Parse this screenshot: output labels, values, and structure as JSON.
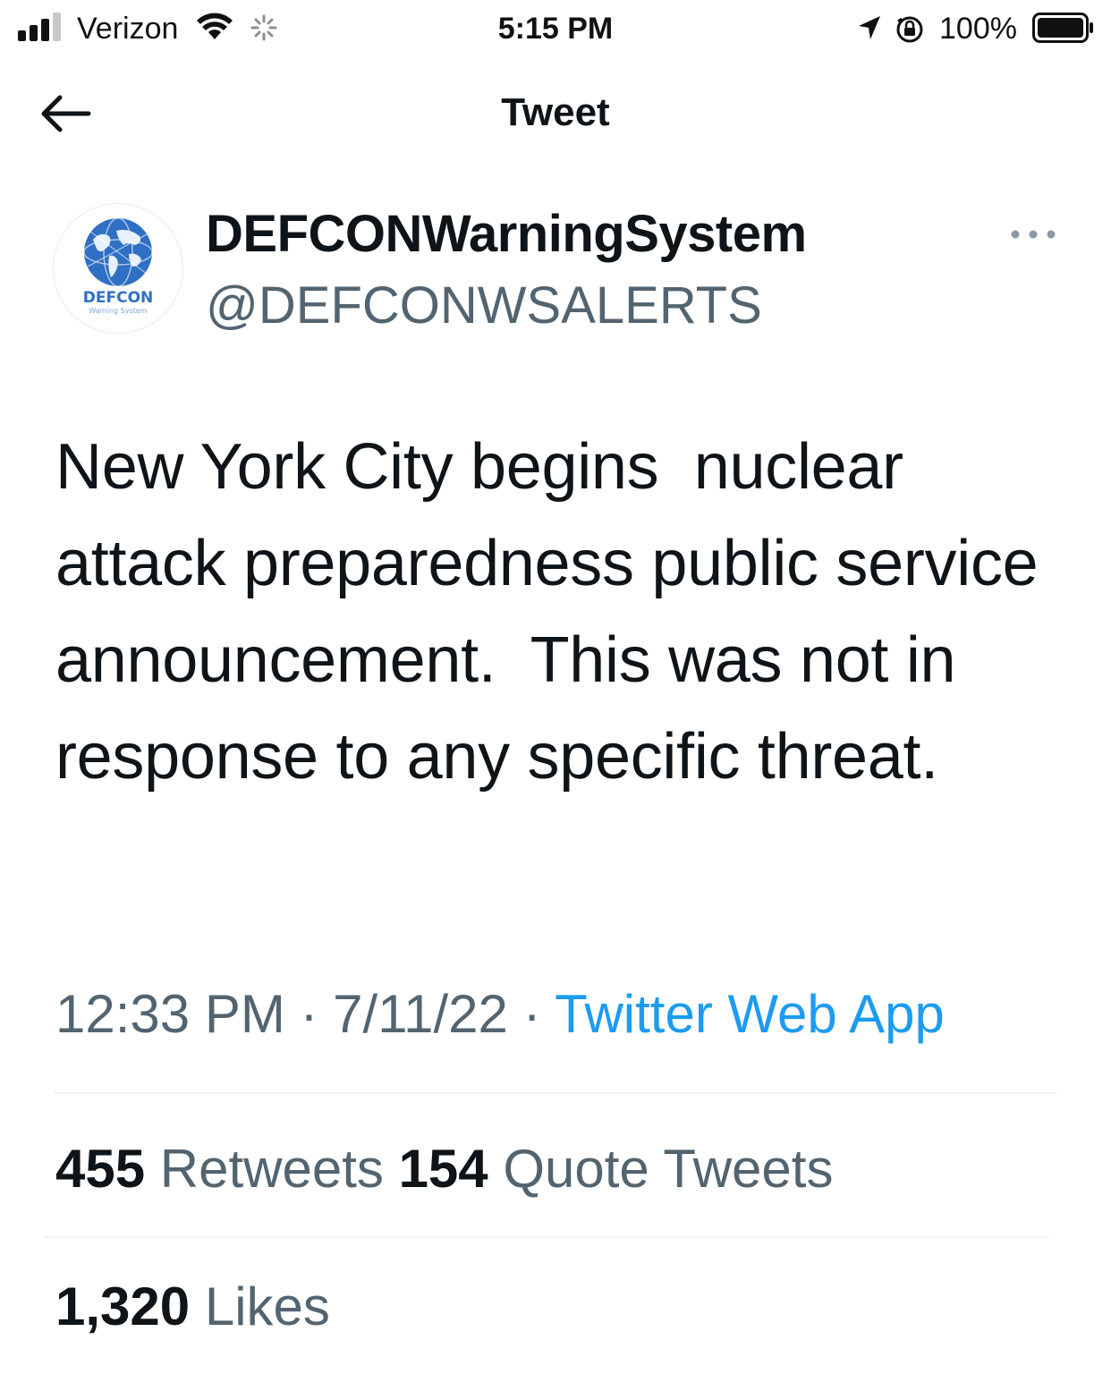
{
  "status_bar": {
    "carrier": "Verizon",
    "time": "5:15 PM",
    "battery_percent": "100%",
    "signal_bars": 3,
    "icons": [
      "signal-icon",
      "wifi-icon",
      "loading-spinner-icon",
      "location-arrow-icon",
      "orientation-lock-icon",
      "battery-icon"
    ]
  },
  "header": {
    "title": "Tweet",
    "back_icon": "arrow-left-icon"
  },
  "author": {
    "display_name": "DEFCONWarningSystem",
    "handle": "@DEFCONWSALERTS",
    "avatar_logo_text": "DEFCON",
    "avatar_logo_subtext": "Warning System",
    "more_icon": "more-horizontal-icon"
  },
  "tweet": {
    "text": "New York City begins  nuclear attack preparedness public service announcement.  This was not in response to any specific threat.",
    "time": "12:33 PM",
    "separator": "·",
    "date": "7/11/22",
    "source": "Twitter Web App"
  },
  "stats": {
    "retweets_count": "455",
    "retweets_label": "Retweets",
    "quotes_count": "154",
    "quotes_label": "Quote Tweets",
    "likes_count": "1,320",
    "likes_label": "Likes"
  },
  "colors": {
    "text_primary": "#0f1419",
    "text_secondary": "#536471",
    "link": "#1d9bf0",
    "divider": "#eff3f4",
    "globe_blue": "#2f6fc4"
  }
}
